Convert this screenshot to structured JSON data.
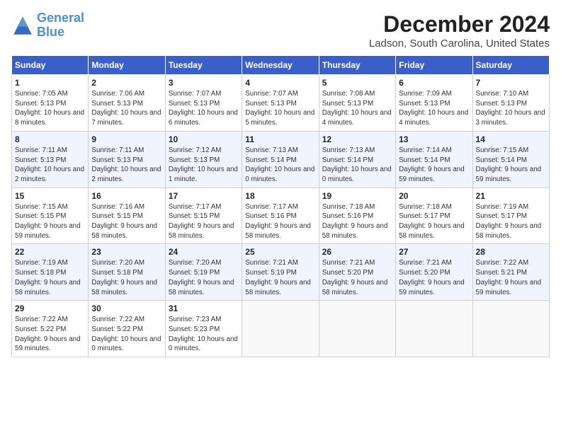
{
  "logo": {
    "line1": "General",
    "line2": "Blue"
  },
  "title": "December 2024",
  "location": "Ladson, South Carolina, United States",
  "days_of_week": [
    "Sunday",
    "Monday",
    "Tuesday",
    "Wednesday",
    "Thursday",
    "Friday",
    "Saturday"
  ],
  "weeks": [
    [
      {
        "day": "1",
        "sunrise": "Sunrise: 7:05 AM",
        "sunset": "Sunset: 5:13 PM",
        "daylight": "Daylight: 10 hours and 8 minutes."
      },
      {
        "day": "2",
        "sunrise": "Sunrise: 7:06 AM",
        "sunset": "Sunset: 5:13 PM",
        "daylight": "Daylight: 10 hours and 7 minutes."
      },
      {
        "day": "3",
        "sunrise": "Sunrise: 7:07 AM",
        "sunset": "Sunset: 5:13 PM",
        "daylight": "Daylight: 10 hours and 6 minutes."
      },
      {
        "day": "4",
        "sunrise": "Sunrise: 7:07 AM",
        "sunset": "Sunset: 5:13 PM",
        "daylight": "Daylight: 10 hours and 5 minutes."
      },
      {
        "day": "5",
        "sunrise": "Sunrise: 7:08 AM",
        "sunset": "Sunset: 5:13 PM",
        "daylight": "Daylight: 10 hours and 4 minutes."
      },
      {
        "day": "6",
        "sunrise": "Sunrise: 7:09 AM",
        "sunset": "Sunset: 5:13 PM",
        "daylight": "Daylight: 10 hours and 4 minutes."
      },
      {
        "day": "7",
        "sunrise": "Sunrise: 7:10 AM",
        "sunset": "Sunset: 5:13 PM",
        "daylight": "Daylight: 10 hours and 3 minutes."
      }
    ],
    [
      {
        "day": "8",
        "sunrise": "Sunrise: 7:11 AM",
        "sunset": "Sunset: 5:13 PM",
        "daylight": "Daylight: 10 hours and 2 minutes."
      },
      {
        "day": "9",
        "sunrise": "Sunrise: 7:11 AM",
        "sunset": "Sunset: 5:13 PM",
        "daylight": "Daylight: 10 hours and 2 minutes."
      },
      {
        "day": "10",
        "sunrise": "Sunrise: 7:12 AM",
        "sunset": "Sunset: 5:13 PM",
        "daylight": "Daylight: 10 hours and 1 minute."
      },
      {
        "day": "11",
        "sunrise": "Sunrise: 7:13 AM",
        "sunset": "Sunset: 5:14 PM",
        "daylight": "Daylight: 10 hours and 0 minutes."
      },
      {
        "day": "12",
        "sunrise": "Sunrise: 7:13 AM",
        "sunset": "Sunset: 5:14 PM",
        "daylight": "Daylight: 10 hours and 0 minutes."
      },
      {
        "day": "13",
        "sunrise": "Sunrise: 7:14 AM",
        "sunset": "Sunset: 5:14 PM",
        "daylight": "Daylight: 9 hours and 59 minutes."
      },
      {
        "day": "14",
        "sunrise": "Sunrise: 7:15 AM",
        "sunset": "Sunset: 5:14 PM",
        "daylight": "Daylight: 9 hours and 59 minutes."
      }
    ],
    [
      {
        "day": "15",
        "sunrise": "Sunrise: 7:15 AM",
        "sunset": "Sunset: 5:15 PM",
        "daylight": "Daylight: 9 hours and 59 minutes."
      },
      {
        "day": "16",
        "sunrise": "Sunrise: 7:16 AM",
        "sunset": "Sunset: 5:15 PM",
        "daylight": "Daylight: 9 hours and 58 minutes."
      },
      {
        "day": "17",
        "sunrise": "Sunrise: 7:17 AM",
        "sunset": "Sunset: 5:15 PM",
        "daylight": "Daylight: 9 hours and 58 minutes."
      },
      {
        "day": "18",
        "sunrise": "Sunrise: 7:17 AM",
        "sunset": "Sunset: 5:16 PM",
        "daylight": "Daylight: 9 hours and 58 minutes."
      },
      {
        "day": "19",
        "sunrise": "Sunrise: 7:18 AM",
        "sunset": "Sunset: 5:16 PM",
        "daylight": "Daylight: 9 hours and 58 minutes."
      },
      {
        "day": "20",
        "sunrise": "Sunrise: 7:18 AM",
        "sunset": "Sunset: 5:17 PM",
        "daylight": "Daylight: 9 hours and 58 minutes."
      },
      {
        "day": "21",
        "sunrise": "Sunrise: 7:19 AM",
        "sunset": "Sunset: 5:17 PM",
        "daylight": "Daylight: 9 hours and 58 minutes."
      }
    ],
    [
      {
        "day": "22",
        "sunrise": "Sunrise: 7:19 AM",
        "sunset": "Sunset: 5:18 PM",
        "daylight": "Daylight: 9 hours and 58 minutes."
      },
      {
        "day": "23",
        "sunrise": "Sunrise: 7:20 AM",
        "sunset": "Sunset: 5:18 PM",
        "daylight": "Daylight: 9 hours and 58 minutes."
      },
      {
        "day": "24",
        "sunrise": "Sunrise: 7:20 AM",
        "sunset": "Sunset: 5:19 PM",
        "daylight": "Daylight: 9 hours and 58 minutes."
      },
      {
        "day": "25",
        "sunrise": "Sunrise: 7:21 AM",
        "sunset": "Sunset: 5:19 PM",
        "daylight": "Daylight: 9 hours and 58 minutes."
      },
      {
        "day": "26",
        "sunrise": "Sunrise: 7:21 AM",
        "sunset": "Sunset: 5:20 PM",
        "daylight": "Daylight: 9 hours and 58 minutes."
      },
      {
        "day": "27",
        "sunrise": "Sunrise: 7:21 AM",
        "sunset": "Sunset: 5:20 PM",
        "daylight": "Daylight: 9 hours and 59 minutes."
      },
      {
        "day": "28",
        "sunrise": "Sunrise: 7:22 AM",
        "sunset": "Sunset: 5:21 PM",
        "daylight": "Daylight: 9 hours and 59 minutes."
      }
    ],
    [
      {
        "day": "29",
        "sunrise": "Sunrise: 7:22 AM",
        "sunset": "Sunset: 5:22 PM",
        "daylight": "Daylight: 9 hours and 59 minutes."
      },
      {
        "day": "30",
        "sunrise": "Sunrise: 7:22 AM",
        "sunset": "Sunset: 5:22 PM",
        "daylight": "Daylight: 10 hours and 0 minutes."
      },
      {
        "day": "31",
        "sunrise": "Sunrise: 7:23 AM",
        "sunset": "Sunset: 5:23 PM",
        "daylight": "Daylight: 10 hours and 0 minutes."
      },
      null,
      null,
      null,
      null
    ]
  ]
}
